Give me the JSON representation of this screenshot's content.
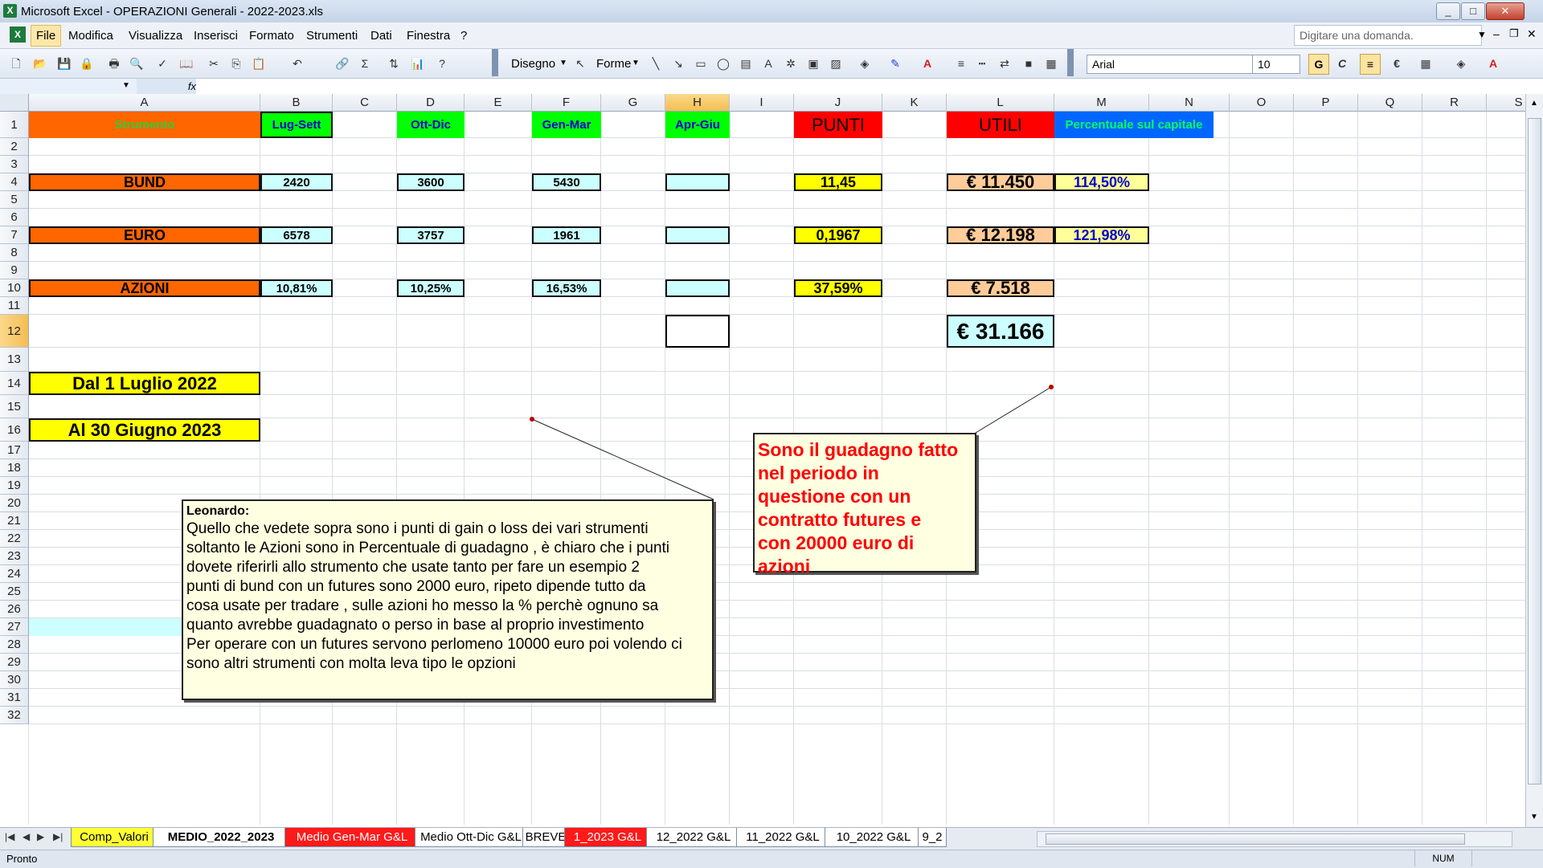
{
  "window": {
    "title": "Microsoft Excel - OPERAZIONI Generali - 2022-2023.xls",
    "minimize": "_",
    "maximize": "□",
    "close": "✕"
  },
  "menu": {
    "items": [
      "File",
      "Modifica",
      "Visualizza",
      "Inserisci",
      "Formato",
      "Strumenti",
      "Dati",
      "Finestra",
      "?"
    ],
    "ask_placeholder": "Digitare una domanda."
  },
  "toolbar": {
    "draw_label": "Disegno",
    "shapes_label": "Forme",
    "font_name": "Arial",
    "font_size": "10",
    "bold": "G",
    "italic": "C",
    "euro": "€",
    "sum": "Σ"
  },
  "formula_bar": {
    "fx": "fx",
    "name_box": ""
  },
  "columns": [
    "A",
    "B",
    "C",
    "D",
    "E",
    "F",
    "G",
    "H",
    "I",
    "J",
    "K",
    "L",
    "M",
    "N",
    "O",
    "P",
    "Q",
    "R",
    "S"
  ],
  "rows": [
    "1",
    "2",
    "3",
    "4",
    "5",
    "6",
    "7",
    "8",
    "9",
    "10",
    "11",
    "12",
    "13",
    "14",
    "15",
    "16",
    "17",
    "18",
    "19",
    "20",
    "21",
    "22",
    "23",
    "24",
    "25",
    "26",
    "27",
    "28",
    "29",
    "30",
    "31",
    "32"
  ],
  "cells": {
    "A1": "Strumento",
    "B1": "Lug-Sett",
    "D1": "Ott-Dic",
    "F1": "Gen-Mar",
    "H1": "Apr-Giu",
    "J1": "PUNTI",
    "L1": "UTILI",
    "M1": "Percentuale sul capitale",
    "A4": "BUND",
    "B4": "2420",
    "D4": "3600",
    "F4": "5430",
    "J4": "11,45",
    "L4": "€ 11.450",
    "M4": "114,50%",
    "A7": "EURO",
    "B7": "6578",
    "D7": "3757",
    "F7": "1961",
    "J7": "0,1967",
    "L7": "€ 12.198",
    "M7": "121,98%",
    "A10": "AZIONI",
    "B10": "10,81%",
    "D10": "10,25%",
    "F10": "16,53%",
    "J10": "37,59%",
    "L10": "€ 7.518",
    "L12": "€ 31.166",
    "A14": "Dal 1 Luglio  2022",
    "A16": "Al 30 Giugno 2023"
  },
  "comments": {
    "leonardo_author": "Leonardo:",
    "leonardo_lines": [
      "Quello che vedete sopra sono i punti di gain o loss dei vari strumenti",
      "soltanto le Azioni sono in Percentuale di guadagno , è chiaro che i punti",
      "dovete riferirli allo strumento che usate tanto per fare un esempio 2",
      "punti di bund con un futures sono 2000 euro, ripeto dipende tutto da",
      "cosa usate per tradare , sulle azioni ho messo la % perchè ognuno sa",
      "quanto avrebbe guadagnato o perso in base al proprio investimento",
      "Per operare con un futures servono perlomeno 10000 euro poi volendo ci",
      "sono altri strumenti con molta leva tipo le opzioni"
    ],
    "guadagno_lines": [
      "Sono il guadagno fatto",
      "nel periodo in",
      "questione con un",
      "contratto futures e",
      "con 20000 euro di",
      "azioni"
    ]
  },
  "sheet_tabs": [
    "Comp_Valori",
    "MEDIO_2022_2023",
    "Medio Gen-Mar G&L",
    "Medio Ott-Dic G&L",
    "BREVE",
    "1_2023 G&L",
    "12_2022 G&L",
    "11_2022 G&L",
    "10_2022 G&L",
    "9_2"
  ],
  "status": {
    "left": "Pronto",
    "right": "NUM"
  },
  "colors": {
    "orange": "#ff6600",
    "green": "#00ff00",
    "cyan": "#ccffff",
    "yellow": "#ffff00",
    "red": "#ff0000",
    "peach": "#ffcc99",
    "light_yellow": "#ffff99",
    "blue": "#0066ff"
  }
}
